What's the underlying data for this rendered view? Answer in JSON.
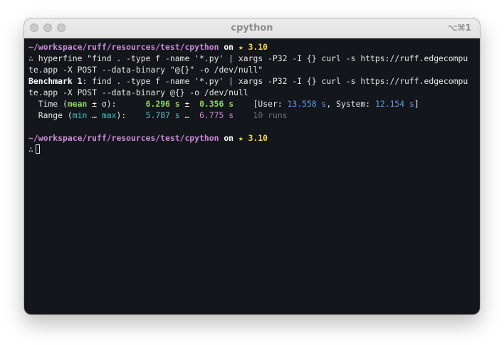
{
  "window": {
    "title": "cpython",
    "shortcut": "⌥⌘1"
  },
  "prompt": {
    "path": "~/workspace/ruff/resources/test/cpython",
    "on": "on",
    "python_version": "★ 3.10",
    "symbol": "∴"
  },
  "command": {
    "line1": "hyperfine \"find . -type f -name '*.py' | xargs -P32 -I {} curl -s https://ruff.edgecompu",
    "line2": "te.app -X POST --data-binary \"@{}\" -o /dev/null\""
  },
  "benchmark": {
    "label": "Benchmark 1",
    "line1": ": find . -type f -name '*.py' | xargs -P32 -I {} curl -s https://ruff.edgecompu",
    "line2": "te.app -X POST --data-binary @{} -o /dev/null",
    "time": {
      "prefix": "  Time (",
      "mean_label": "mean",
      "pm_sigma": " ± σ):",
      "gap1": "      ",
      "mean_value": "6.296 s",
      "pm": " ±  ",
      "sigma_value": "0.356 s",
      "gap2": "    ",
      "user_open": "[User: ",
      "user_value": "13.558 s",
      "system_label": ", System: ",
      "system_value": "12.154 s",
      "close": "]"
    },
    "range": {
      "prefix": "  Range (",
      "min_label": "min",
      "ellipsis": " … ",
      "max_label": "max",
      "suffix": "):",
      "gap1": "    ",
      "min_value": "5.787 s",
      "between": " …  ",
      "max_value": "6.775 s",
      "gap2": "    ",
      "runs": "10 runs"
    }
  },
  "colors": {
    "terminal_bg": "#13161b",
    "path": "#c98bd8",
    "python_version": "#f3d34a",
    "mean": "#8fd45f",
    "stat": "#5d9ae0"
  }
}
